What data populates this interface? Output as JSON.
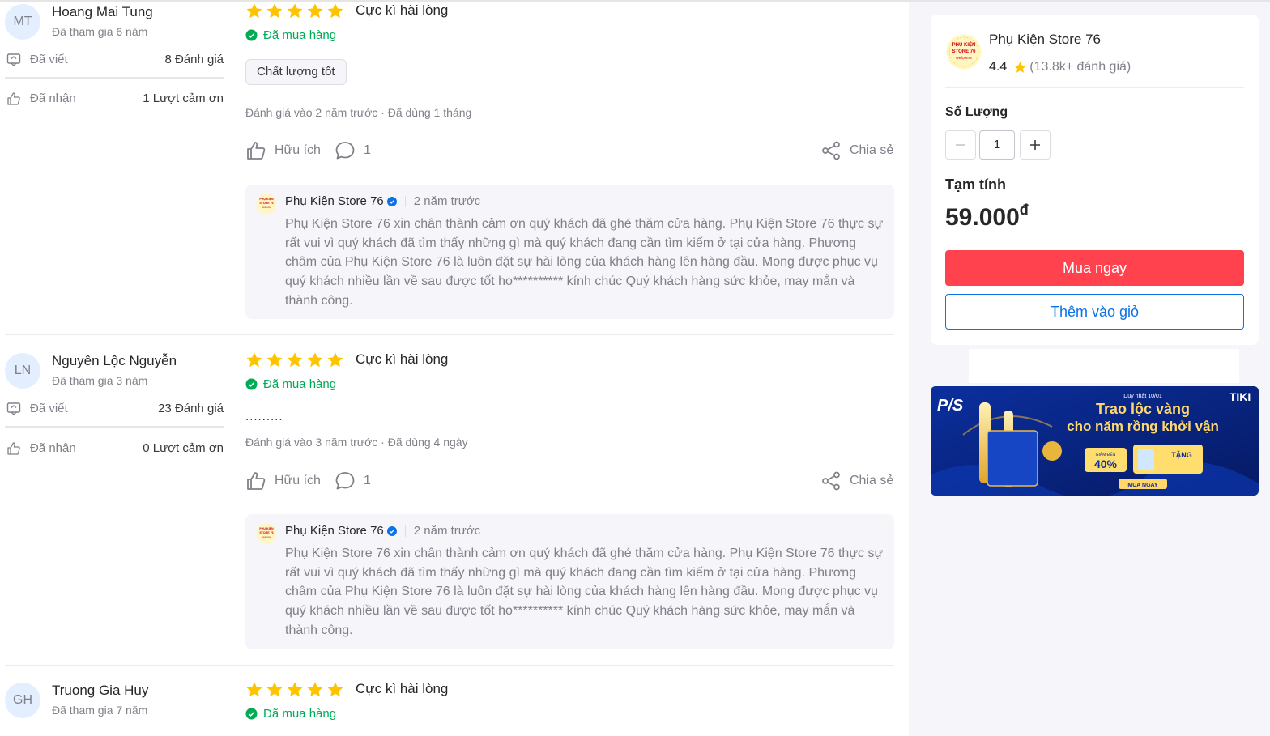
{
  "reviews": [
    {
      "initials": "MT",
      "name": "Hoang Mai Tung",
      "joined": "Đã tham gia 6 năm",
      "written_label": "Đã viết",
      "written_value": "8 Đánh giá",
      "received_label": "Đã nhận",
      "received_value": "1 Lượt cảm ơn",
      "stars": 5,
      "title": "Cực kì hài lòng",
      "bought": "Đã mua hàng",
      "tag": "Chất lượng tốt",
      "text": "",
      "meta": "Đánh giá vào 2 năm trước  ·  Đã dùng 1 tháng",
      "helpful": "Hữu ích",
      "comments": "1",
      "share": "Chia sẻ",
      "reply": {
        "shop": "Phụ Kiện Store 76",
        "time": "2 năm trước",
        "text": "Phụ Kiện Store 76 xin chân thành cảm ơn quý khách đã ghé thăm cửa hàng. Phụ Kiện Store 76 thực sự rất vui vì quý khách đã tìm thấy những gì mà quý khách đang cần tìm kiếm ở tại cửa hàng. Phương châm của Phụ Kiện Store 76 là luôn đặt sự hài lòng của khách hàng lên hàng đầu. Mong được phục vụ quý khách nhiều lần về sau được tốt ho********** kính chúc Quý khách hàng sức khỏe, may mắn và thành công."
      }
    },
    {
      "initials": "LN",
      "name": "Nguyên Lộc Nguyễn",
      "joined": "Đã tham gia 3 năm",
      "written_label": "Đã viết",
      "written_value": "23 Đánh giá",
      "received_label": "Đã nhận",
      "received_value": "0 Lượt cảm ơn",
      "stars": 5,
      "title": "Cực kì hài lòng",
      "bought": "Đã mua hàng",
      "tag": "",
      "text": ".........",
      "meta": "Đánh giá vào 3 năm trước  ·  Đã dùng 4 ngày",
      "helpful": "Hữu ích",
      "comments": "1",
      "share": "Chia sẻ",
      "reply": {
        "shop": "Phụ Kiện Store 76",
        "time": "2 năm trước",
        "text": "Phụ Kiện Store 76 xin chân thành cảm ơn quý khách đã ghé thăm cửa hàng. Phụ Kiện Store 76 thực sự rất vui vì quý khách đã tìm thấy những gì mà quý khách đang cần tìm kiếm ở tại cửa hàng. Phương châm của Phụ Kiện Store 76 là luôn đặt sự hài lòng của khách hàng lên hàng đầu. Mong được phục vụ quý khách nhiều lần về sau được tốt ho********** kính chúc Quý khách hàng sức khỏe, may mắn và thành công."
      }
    },
    {
      "initials": "GH",
      "name": "Truong Gia Huy",
      "joined": "Đã tham gia 7 năm",
      "stars": 5,
      "title": "Cực kì hài lòng",
      "bought": "Đã mua hàng"
    }
  ],
  "store": {
    "logo_text_1": "PHỤ KIỆN",
    "logo_text_2": "STORE 76",
    "logo_text_3": "welcome",
    "name": "Phụ Kiện Store 76",
    "rating": "4.4",
    "review_count": "(13.8k+ đánh giá)"
  },
  "purchase": {
    "quantity_label": "Số Lượng",
    "quantity": "1",
    "subtotal_label": "Tạm tính",
    "price": "59.000",
    "currency": "đ",
    "buy_now": "Mua ngay",
    "add_to_cart": "Thêm vào giỏ"
  },
  "banner": {
    "brand": "P/S",
    "top_note": "Duy nhất 10/01",
    "headline_1": "Trao lộc vàng",
    "headline_2": "cho năm rồng khởi vận",
    "discount_label": "GIẢM ĐẾN",
    "discount": "40%",
    "gift_label": "TẶNG",
    "cta": "MUA NGAY",
    "marketplace": "TIKI"
  },
  "colors": {
    "star": "#ffc400",
    "bought_green": "#00ab56",
    "buy_red": "#ff424e",
    "cart_blue": "#0b74e5",
    "banner_blue": "#0a2a8c"
  }
}
